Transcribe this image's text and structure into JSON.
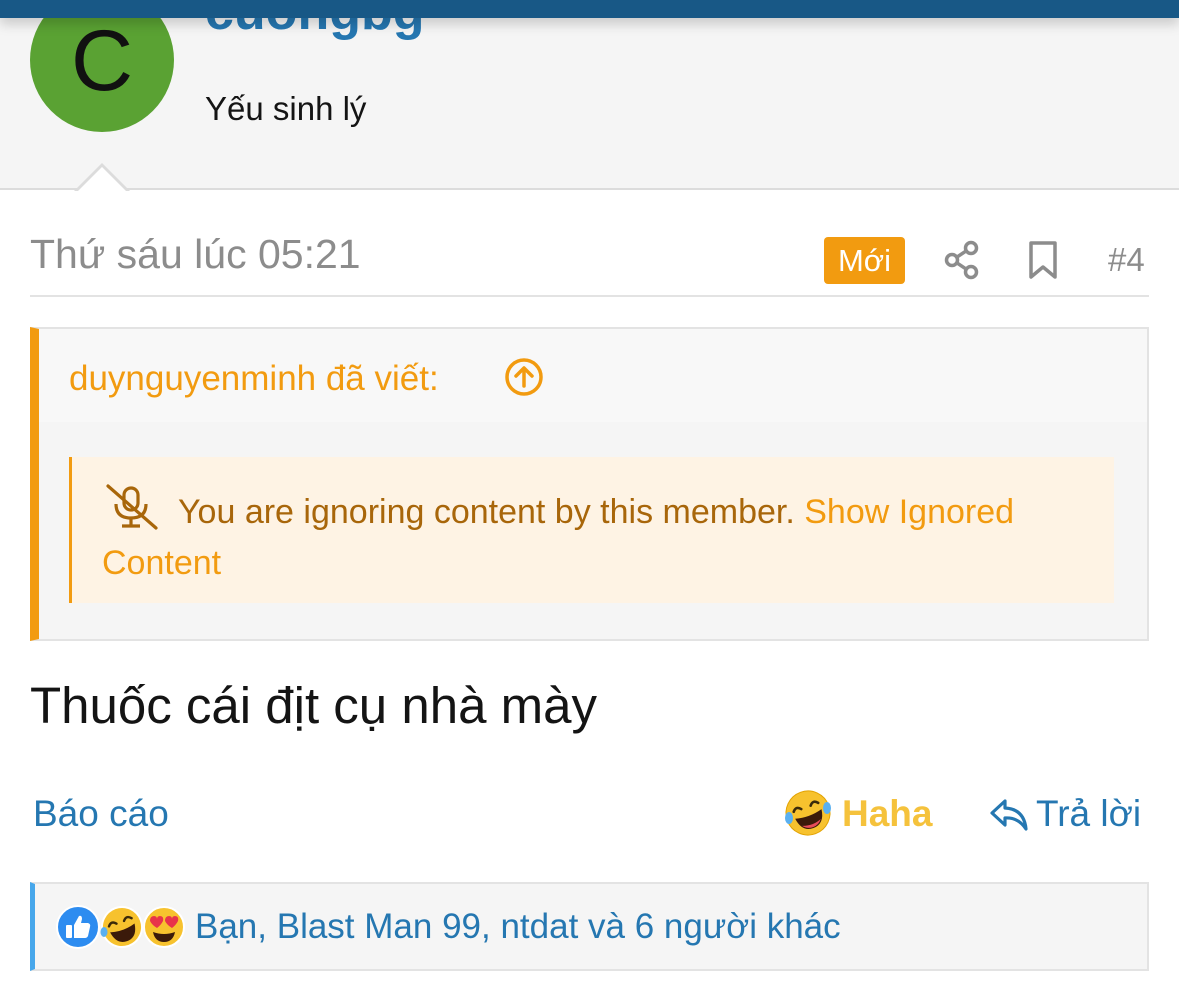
{
  "user": {
    "avatar_letter": "C",
    "username": "cuongbg",
    "title": "Yếu sinh lý"
  },
  "post": {
    "date": "Thứ sáu lúc 05:21",
    "new_badge": "Mới",
    "number": "#4",
    "body": "Thuốc cái địt cụ nhà mày"
  },
  "quote": {
    "author_line": "duynguyenminh đã viết:",
    "ignored_message": "You are ignoring content by this member. ",
    "show_ignored_link": "Show Ignored Content"
  },
  "actions": {
    "report": "Báo cáo",
    "reaction_label": "Haha",
    "reply": "Trả lời"
  },
  "reactions": {
    "summary": "Bạn, Blast Man 99, ntdat và 6 người khác",
    "icons": [
      "like-icon",
      "haha-emoji-icon",
      "love-emoji-icon"
    ]
  },
  "colors": {
    "link_blue": "#2577b1",
    "accent_orange": "#f29b10",
    "avatar_green": "#5aa233",
    "haha_yellow": "#f5c23c",
    "top_bar": "#185886"
  }
}
